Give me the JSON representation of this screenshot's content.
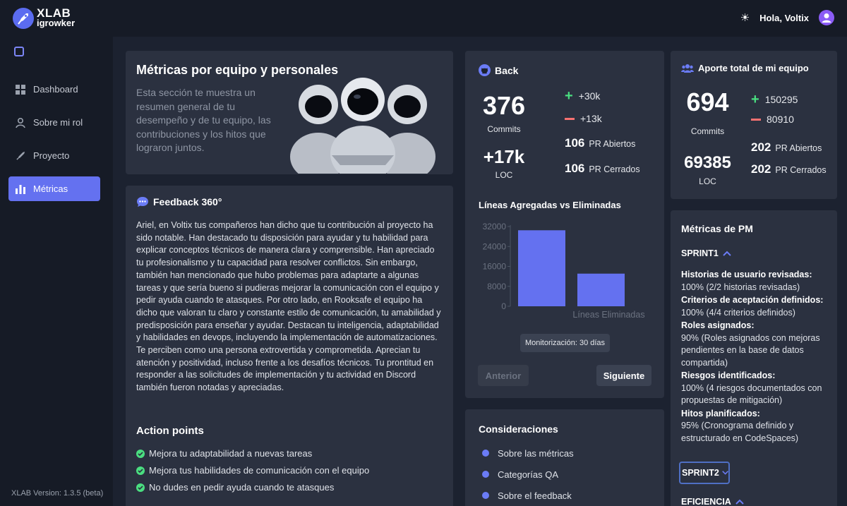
{
  "brand": {
    "line1": "XLAB",
    "line2": "igrowker"
  },
  "header": {
    "greeting": "Hola, Voltix",
    "theme_icon": "sun-icon",
    "avatar_icon": "user-icon"
  },
  "sidebar": {
    "items": [
      {
        "label": "Dashboard",
        "icon": "dashboard-icon",
        "active": false
      },
      {
        "label": "Sobre mi rol",
        "icon": "user-icon",
        "active": false
      },
      {
        "label": "Proyecto",
        "icon": "rocket-icon",
        "active": false
      },
      {
        "label": "Métricas",
        "icon": "bar-chart-icon",
        "active": true
      }
    ],
    "version": "XLAB Version: 1.3.5 (beta)"
  },
  "intro": {
    "title": "Métricas por equipo y personales",
    "text": "Esta sección te muestra un resumen general de tu desempeño y de tu equipo, las contribuciones y los hitos que lograron juntos."
  },
  "feedback": {
    "title": "Feedback 360°",
    "body": "Ariel, en Voltix tus compañeros han dicho que tu contribución al proyecto ha sido notable. Han destacado tu disposición para ayudar y tu habilidad para explicar conceptos técnicos de manera clara y comprensible. Han apreciado tu profesionalismo y tu capacidad para resolver conflictos. Sin embargo, también han mencionado que hubo problemas para adaptarte a algunas tareas y que sería bueno si pudieras mejorar la comunicación con el equipo y pedir ayuda cuando te atasques. Por otro lado, en Rooksafe el equipo ha dicho que valoran tu claro y constante estilo de comunicación, tu amabilidad y predisposición para enseñar y ayudar. Destacan tu inteligencia, adaptabilidad y habilidades en devops, incluyendo la implementación de automatizaciones. Te perciben como una persona extrovertida y comprometida. Aprecian tu atención y positividad, incluso frente a los desafíos técnicos. Tu prontitud en responder a las solicitudes de implementación y tu actividad en Discord también fueron notadas y apreciadas.",
    "action_title": "Action points",
    "actions": [
      "Mejora tu adaptabilidad a nuevas tareas",
      "Mejora tus habilidades de comunicación con el equipo",
      "No dudes en pedir ayuda cuando te atasques"
    ]
  },
  "back": {
    "title": "Back",
    "commits_value": "376",
    "commits_label": "Commits",
    "loc_value": "+17k",
    "loc_label": "LOC",
    "added": "+30k",
    "removed": "+13k",
    "pr_open_value": "106",
    "pr_open_label": "PR Abiertos",
    "pr_closed_value": "106",
    "pr_closed_label": "PR Cerrados",
    "chart_title": "Líneas Agregadas vs Eliminadas",
    "tooltip": "Monitorización: 30 días",
    "prev_button": "Anterior",
    "next_button": "Siguiente"
  },
  "chart_data": {
    "type": "bar",
    "title": "Líneas Agregadas vs Eliminadas",
    "categories": [
      "",
      "Líneas Eliminadas"
    ],
    "values": [
      30500,
      13100
    ],
    "yticks": [
      0,
      8000,
      16000,
      24000,
      32000
    ],
    "ylim": [
      0,
      32000
    ],
    "color": "#6471f0",
    "grid": false
  },
  "team": {
    "title": "Aporte total de mi equipo",
    "commits_value": "694",
    "commits_label": "Commits",
    "added": "150295",
    "removed": "80910",
    "loc_value": "69385",
    "loc_label": "LOC",
    "pr_open_value": "202",
    "pr_open_label": "PR Abiertos",
    "pr_closed_value": "202",
    "pr_closed_label": "PR Cerrados"
  },
  "pm": {
    "title": "Métricas de PM",
    "sprint1": "SPRINT1",
    "items": [
      {
        "label": "Historias de usuario revisadas:",
        "value": "100% (2/2 historias revisadas)"
      },
      {
        "label": "Criterios de aceptación definidos:",
        "value": "100% (4/4 criterios definidos)"
      },
      {
        "label": "Roles asignados:",
        "value": "90% (Roles asignados con mejoras pendientes en la base de datos compartida)"
      },
      {
        "label": "Riesgos identificados:",
        "value": "100% (4 riesgos documentados con propuestas de mitigación)"
      },
      {
        "label": "Hitos planificados:",
        "value": "95% (Cronograma definido y estructurado en CodeSpaces)"
      }
    ],
    "sprint2": "SPRINT2",
    "efficiency": "EFICIENCIA"
  },
  "considerations": {
    "title": "Consideraciones",
    "items": [
      "Sobre las métricas",
      "Categorías QA",
      "Sobre el feedback"
    ]
  },
  "colors": {
    "accent": "#6471f0",
    "positive": "#4ade80",
    "negative": "#f87171",
    "card": "#2b3140",
    "background": "#1c2230"
  }
}
